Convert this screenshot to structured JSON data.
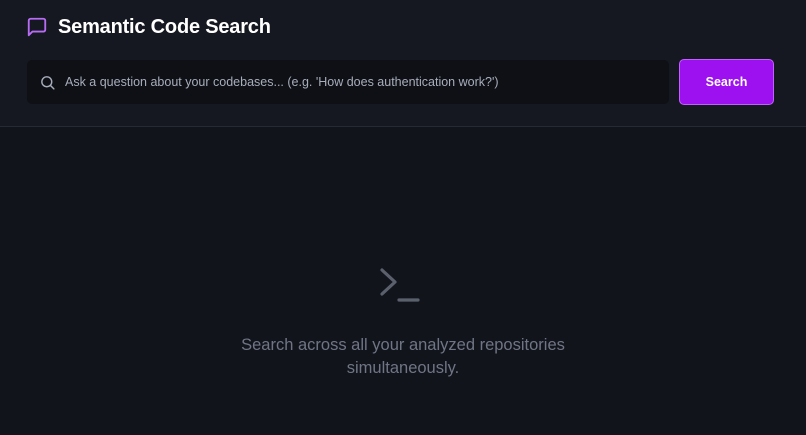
{
  "header": {
    "title": "Semantic Code Search",
    "icon": "message-square-icon"
  },
  "search": {
    "placeholder": "Ask a question about your codebases... (e.g. 'How does authentication work?')",
    "value": "",
    "button_label": "Search"
  },
  "empty_state": {
    "icon": "terminal-icon",
    "message": "Search across all your analyzed repositories simultaneously."
  },
  "colors": {
    "background": "#12141c",
    "header_background": "#161821",
    "accent": "#9d10f0",
    "accent_icon": "#b86cf5",
    "muted_text": "#6f7584"
  }
}
